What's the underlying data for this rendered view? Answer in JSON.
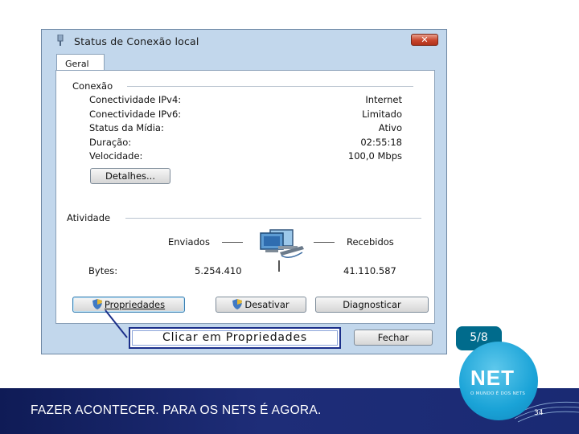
{
  "window": {
    "title": "Status de Conexão local",
    "close_label": "✕",
    "tab": "Geral"
  },
  "connection": {
    "section_label": "Conexão",
    "rows": [
      {
        "label": "Conectividade IPv4:",
        "value": "Internet"
      },
      {
        "label": "Conectividade IPv6:",
        "value": "Limitado"
      },
      {
        "label": "Status da Mídia:",
        "value": "Ativo"
      },
      {
        "label": "Duração:",
        "value": "02:55:18"
      },
      {
        "label": "Velocidade:",
        "value": "100,0 Mbps"
      }
    ],
    "details_button": "Detalhes..."
  },
  "activity": {
    "section_label": "Atividade",
    "sent_label": "Enviados",
    "received_label": "Recebidos",
    "bytes_label": "Bytes:",
    "bytes_sent": "5.254.410",
    "bytes_received": "41.110.587"
  },
  "buttons": {
    "properties": "Propriedades",
    "disable": "Desativar",
    "diagnose": "Diagnosticar",
    "close": "Fechar"
  },
  "callout": {
    "text": "Clicar em Propriedades"
  },
  "slide": {
    "step_badge": "5/8",
    "footer_text": "FAZER ACONTECER. PARA OS NETS É AGORA.",
    "logo_text": "NET",
    "logo_tagline": "O MUNDO É DOS NETS",
    "page_number": "34"
  },
  "colors": {
    "footer_bg": "#1e2d78",
    "badge_bg": "#006b8c",
    "logo_blue": "#1aa3d7",
    "window_frame": "#c2d7ec",
    "callout_border": "#1b2f8a"
  }
}
